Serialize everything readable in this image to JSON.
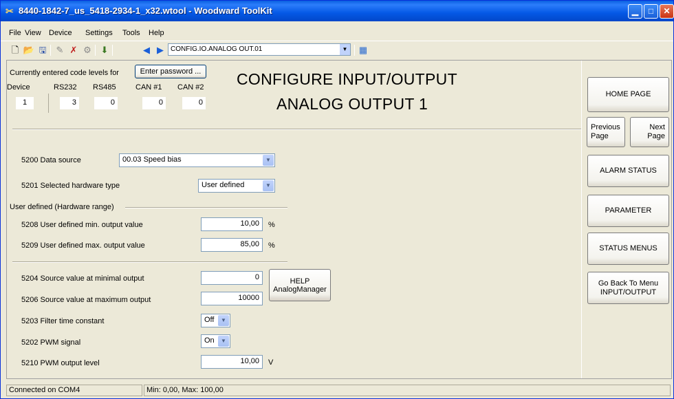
{
  "window": {
    "title": "8440-1842-7_us_5418-2934-1_x32.wtool - Woodward ToolKit"
  },
  "menu": [
    "File",
    "View",
    "Device",
    "Settings",
    "Tools",
    "Help"
  ],
  "toolbar": {
    "path": "CONFIG.IO.ANALOG OUT.01"
  },
  "codes": {
    "intro": "Currently entered code levels for",
    "enter_password": "Enter password ...",
    "headers": [
      "Device",
      "RS232",
      "RS485",
      "CAN #1",
      "CAN #2"
    ],
    "values": [
      "1",
      "3",
      "0",
      "0",
      "0"
    ]
  },
  "page": {
    "title_line1": "CONFIGURE INPUT/OUTPUT",
    "title_line2": "ANALOG OUTPUT 1"
  },
  "params": {
    "p5200": {
      "label": "5200 Data source",
      "value": "00.03 Speed bias"
    },
    "p5201": {
      "label": "5201 Selected hardware type",
      "value": "User defined"
    },
    "section": "User defined (Hardware range)",
    "p5208": {
      "label": "5208 User defined min. output value",
      "value": "10,00",
      "unit": "%"
    },
    "p5209": {
      "label": "5209 User defined max. output value",
      "value": "85,00",
      "unit": "%"
    },
    "p5204": {
      "label": "5204 Source value at minimal output",
      "value": "0"
    },
    "p5206": {
      "label": "5206 Source value at maximum output",
      "value": "10000"
    },
    "p5203": {
      "label": "5203 Filter time constant",
      "value": "Off"
    },
    "p5202": {
      "label": "5202 PWM signal",
      "value": "On"
    },
    "p5210": {
      "label": "5210 PWM output level",
      "value": "10,00",
      "unit": "V"
    }
  },
  "help": {
    "line1": "HELP",
    "line2": "AnalogManager"
  },
  "nav": {
    "home": "HOME PAGE",
    "prev": "Previous Page",
    "next": "Next Page",
    "alarm": "ALARM STATUS",
    "parameter": "PARAMETER",
    "status": "STATUS MENUS",
    "back": "Go Back To Menu INPUT/OUTPUT"
  },
  "status": {
    "connection": "Connected on COM4",
    "range": "Min: 0,00, Max: 100,00"
  }
}
